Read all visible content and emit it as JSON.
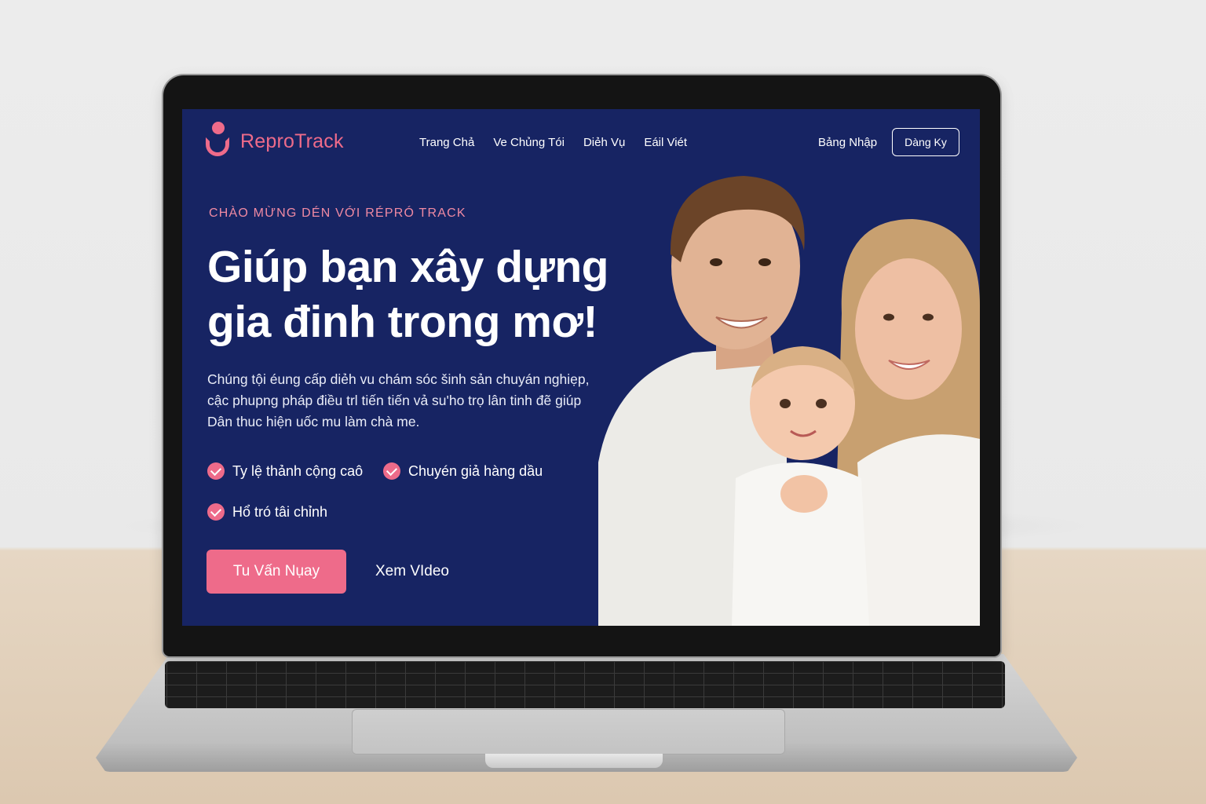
{
  "brand": {
    "name": "ReproTrack",
    "color": "#ee6b8a"
  },
  "nav": {
    "items": [
      "Trang Chả",
      "Ve Chủng Tói",
      "Diẻh Vụ",
      "Eáil Viét"
    ],
    "login": "Bảng Nhập",
    "signup": "Dàng Ky"
  },
  "hero": {
    "eyebrow": "CHÀO MỪNG DÉN VỚI RÉPRÓ TRACK",
    "headline_line1": "Giúp bạn xây dựng",
    "headline_line2": "gia đinh trong mơ!",
    "description_line1": "Chúng tội éung cấp diẻh vu chám sóc šinh sản chuyán nghiẹp,",
    "description_line2": "cậc phupng pháp điều trl tiến tiến vả su'ho trọ lân tinh đẽ giúp",
    "description_line3": "Dân thuc hiện uốc mu làm chà me.",
    "features": [
      "Ty lệ thảnh cộng caô",
      "Chuyén giả hàng dầu",
      "Hổ tró tâi chỉnh"
    ],
    "cta_primary": "Tu Vấn Nụay",
    "cta_secondary": "Xem VIdeo"
  },
  "colors": {
    "background": "#172463",
    "accent": "#ee6b8a",
    "text": "#ffffff"
  },
  "image": {
    "subject": "family-photo"
  }
}
